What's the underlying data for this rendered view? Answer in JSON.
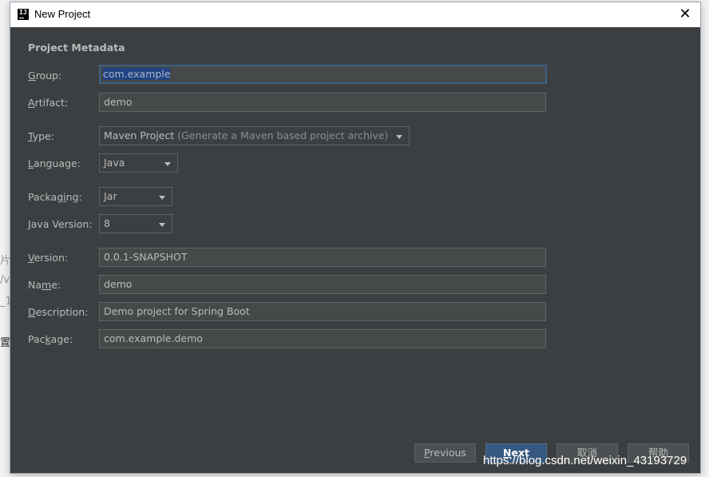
{
  "background": {
    "frag1": "片",
    "frag2": "/v",
    "frag3": "_1",
    "frag4": "置 前"
  },
  "window": {
    "title": "New Project",
    "icon_text": "IJ",
    "close_glyph": "✕"
  },
  "form": {
    "section_title": "Project Metadata",
    "group": {
      "label_pre": "",
      "label_mn": "G",
      "label_post": "roup:",
      "value": "com.example"
    },
    "artifact": {
      "label_pre": "",
      "label_mn": "A",
      "label_post": "rtifact:",
      "value": "demo"
    },
    "type": {
      "label_pre": "",
      "label_mn": "T",
      "label_post": "ype:",
      "value": "Maven Project",
      "hint": "(Generate a Maven based project archive)"
    },
    "language": {
      "label_pre": "",
      "label_mn": "L",
      "label_post": "anguage:",
      "value": "Java"
    },
    "packaging": {
      "label_pre": "Packag",
      "label_mn": "i",
      "label_post": "ng:",
      "value": "Jar"
    },
    "java_version": {
      "label_pre": "",
      "label_mn": "J",
      "label_post": "ava Version:",
      "value": "8"
    },
    "version": {
      "label_pre": "",
      "label_mn": "V",
      "label_post": "ersion:",
      "value": "0.0.1-SNAPSHOT"
    },
    "name": {
      "label_pre": "Na",
      "label_mn": "m",
      "label_post": "e:",
      "value": "demo"
    },
    "description": {
      "label_pre": "",
      "label_mn": "D",
      "label_post": "escription:",
      "value": "Demo project for Spring Boot"
    },
    "package": {
      "label_pre": "Pac",
      "label_mn": "k",
      "label_post": "age:",
      "value": "com.example.demo"
    }
  },
  "buttons": {
    "previous_mn": "P",
    "previous_rest": "revious",
    "next_mn": "N",
    "next_rest": "ext",
    "cancel": "取消",
    "help": "帮助"
  },
  "watermark": "https://blog.csdn.net/weixin_43193729"
}
